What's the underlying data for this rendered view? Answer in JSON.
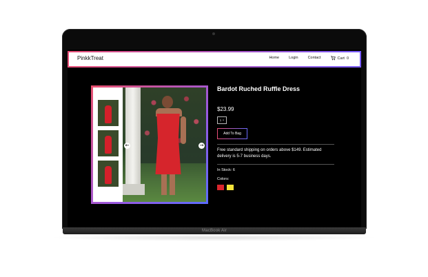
{
  "navbar": {
    "brand": "PinkkTreat",
    "links": [
      "Home",
      "Login",
      "Contact"
    ],
    "cart_label": "Cart",
    "cart_count": "0"
  },
  "product": {
    "title": "Bardot Ruched Ruffle Dress",
    "price": "$23.99",
    "quantity": "1",
    "add_button": "Add To Bag",
    "shipping_note": "Free standard shipping on orders above $149. Estimated delivery is 5-7 business days.",
    "stock_text": "In Stock: 6",
    "colors_label": "Colors:",
    "colors": [
      "#d9262d",
      "#f4e43a"
    ]
  },
  "gallery": {
    "prev_icon": "chevron-left-icon",
    "next_icon": "chevron-right-icon"
  },
  "device": {
    "base_label": "MacBook Air"
  },
  "theme": {
    "gradient_start": "#e94e77",
    "gradient_end": "#6a6bff"
  }
}
